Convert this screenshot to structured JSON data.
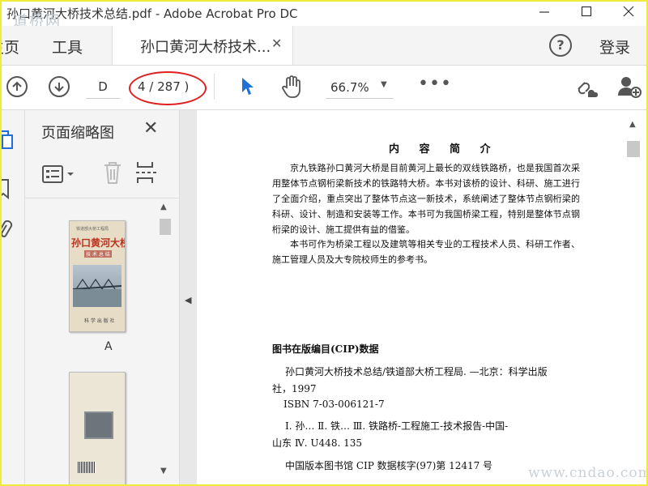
{
  "window": {
    "title": "孙口黄河大桥技术总结.pdf - Adobe Acrobat Pro DC",
    "logo_watermark": "道桥网",
    "controls": [
      "minimize",
      "maximize",
      "close"
    ]
  },
  "menubar": {
    "home": "主页",
    "tools": "工具",
    "doc_tab": "孙口黄河大桥技术...",
    "help_icon": "?",
    "login": "登录"
  },
  "toolbar": {
    "page_input": "D",
    "page_count": "4 / 287 )",
    "zoom": "66.7%",
    "more": "•••"
  },
  "thumbnail_panel": {
    "title": "页面缩略图",
    "thumb1": {
      "series": "铁道部大桥工程局",
      "book_title": "孙口黄河大桥",
      "subtitle": "技 术 总 结",
      "publisher": "科 学 出 版 社",
      "label": "A"
    }
  },
  "document": {
    "heading": "内 容 简 介",
    "para1": "京九铁路孙口黄河大桥是目前黄河上最长的双线铁路桥，也是我国首次采用整体节点钢桁梁新技术的铁路特大桥。本书对该桥的设计、科研、施工进行了全面介绍，重点突出了整体节点这一新技术，系统阐述了整体节点钢桁梁的科研、设计、制造和安装等工作。本书可为我国桥梁工程，特别是整体节点钢桁梁的设计、施工提供有益的借鉴。",
    "para2": "本书可作为桥梁工程以及建筑等相关专业的工程技术人员、科研工作者、施工管理人员及大专院校师生的参考书。",
    "cip_heading": "图书在版编目(CIP)数据",
    "cip_line1": "孙口黄河大桥技术总结/铁道部大桥工程局. —北京：科学出版",
    "cip_line2": "社，1997",
    "isbn": "ISBN 7-03-006121-7",
    "class_line1": "Ⅰ. 孙…   Ⅱ. 铁…   Ⅲ. 铁路桥-工程施工-技术报告-中国-",
    "class_line2": "山东   Ⅳ. U448. 135",
    "cip_number": "中国版本图书馆 CIP 数据核字(97)第 12417 号"
  },
  "footer_watermark": "www.cndao.com",
  "colors": {
    "frame": "#f0ea3a",
    "highlight_oval": "#e02020",
    "accent_cursor": "#1f6fd6"
  }
}
